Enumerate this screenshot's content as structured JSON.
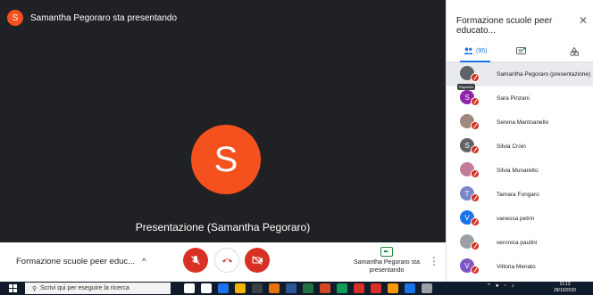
{
  "stage": {
    "presenter_initial": "S",
    "presenter_banner": "Samantha Pegoraro sta presentando",
    "presentation_label": "Presentazione (Samantha Pegoraro)"
  },
  "controls": {
    "meeting_name": "Formazione scuole peer educ...",
    "present_label": "Samantha Pegoraro sta presentando",
    "more_label": "⋮"
  },
  "sidebar": {
    "title": "Formazione scuole peer educato...",
    "close": "✕",
    "people_count": "(95)",
    "tooltip": "Riquadro",
    "participants": [
      {
        "initial": "",
        "name": "Samantha Pegoraro (presentazione)",
        "color": "#5f6368"
      },
      {
        "initial": "S",
        "name": "Sara Pinzani",
        "color": "#8e24aa"
      },
      {
        "initial": "",
        "name": "Serena Mantoanello",
        "color": "#a1887f"
      },
      {
        "initial": "S",
        "name": "Silvia Croin",
        "color": "#5f6368"
      },
      {
        "initial": "",
        "name": "Silvia Munaretto",
        "color": "#c27c9a"
      },
      {
        "initial": "T",
        "name": "Tamara Fongaro",
        "color": "#7986cb"
      },
      {
        "initial": "V",
        "name": "vanessa petrin",
        "color": "#1a73e8"
      },
      {
        "initial": "",
        "name": "veronica paulini",
        "color": "#9aa0a6"
      },
      {
        "initial": "V",
        "name": "Vittoria Menato",
        "color": "#7e57c2"
      }
    ]
  },
  "taskbar": {
    "search_placeholder": "Scrivi qui per eseguire la ricerca",
    "time": "11:13",
    "date": "28/10/2020",
    "icon_colors": [
      "#ffffff",
      "#ffffff",
      "#1a73e8",
      "#f4b400",
      "#3c4043",
      "#e8710a",
      "#2b579a",
      "#217346",
      "#d24726",
      "#0f9d58",
      "#d93025",
      "#d93025",
      "#ff9800",
      "#1a73e8",
      "#9aa0a6"
    ]
  }
}
